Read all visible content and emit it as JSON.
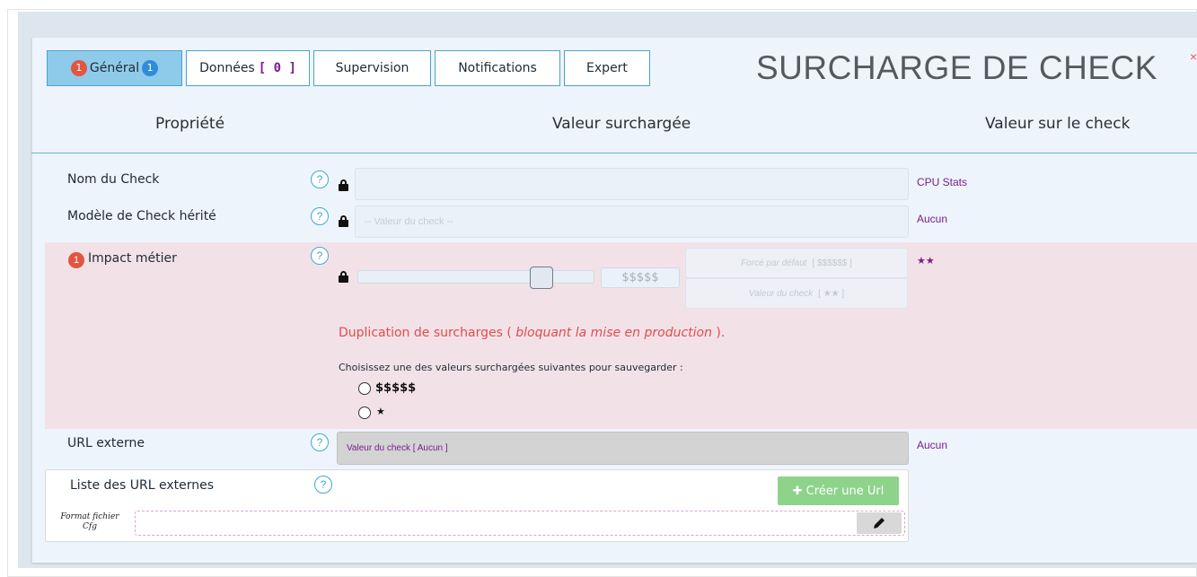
{
  "tabs": [
    {
      "label": "Général",
      "badge_left": "1",
      "badge_right": "1"
    },
    {
      "label": "Données",
      "suffix": "[ 0 ]"
    },
    {
      "label": "Supervision"
    },
    {
      "label": "Notifications"
    },
    {
      "label": "Expert"
    }
  ],
  "title": "SURCHARGE DE CHECK",
  "close": "×",
  "columns": {
    "property": "Propriété",
    "overridden": "Valeur surchargée",
    "check": "Valeur sur le check"
  },
  "rows": {
    "name": {
      "label": "Nom du Check",
      "value": "",
      "check_value": "CPU Stats"
    },
    "template": {
      "label": "Modèle de Check hérité",
      "placeholder": "-- Valeur du check --",
      "check_value": "Aucun"
    },
    "impact": {
      "badge": "1",
      "label": "Impact métier",
      "slider_value": "$$$$$",
      "slider_level": 0.77,
      "forced_label": "Forcé par défaut",
      "forced_value": "[ $$$$$$ ]",
      "check_label": "Valeur du check",
      "check_stars": "[ ★★ ]",
      "check_value": "★★",
      "duplication_prefix": "Duplication de surcharges ( ",
      "duplication_emph": "bloquant la mise en production",
      "duplication_suffix": " ).",
      "choose_text": "Choisissez une des valeurs surchargées suivantes pour sauvegarder :",
      "options": [
        "$$$$$",
        "★"
      ]
    },
    "url": {
      "label": "URL externe",
      "value": "Valeur du check [ Aucun ]",
      "check_value": "Aucun"
    },
    "url_list": {
      "label": "Liste des URL externes",
      "create_button": "✚ Créer une Url",
      "format_label": "Format fichier Cfg"
    }
  },
  "help_glyph": "?",
  "colors": {
    "accent": "#4ba3c7",
    "active_tab": "#8ecbea",
    "error": "#e24c4c",
    "check_value": "#7a1e8c",
    "create_button": "#8dd38a"
  }
}
